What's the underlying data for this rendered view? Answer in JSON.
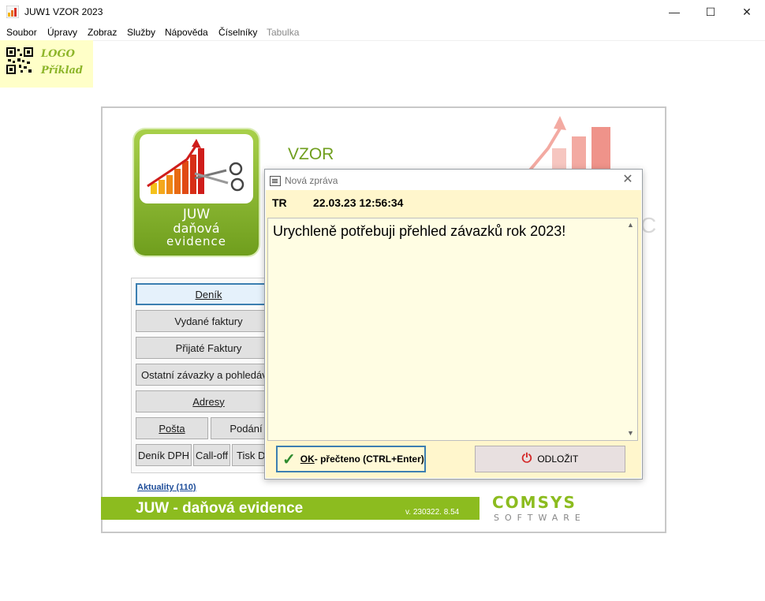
{
  "window": {
    "title": "JUW1 VZOR 2023",
    "minimize_glyph": "—",
    "maximize_glyph": "☐",
    "close_glyph": "✕"
  },
  "menu": [
    "Soubor",
    "Úpravy",
    "Zobraz",
    "Služby",
    "Nápověda",
    "Číselníky",
    "Tabulka"
  ],
  "logo": {
    "line1": "LOGO",
    "line2": "Příklad",
    "icon": "qr-code-icon"
  },
  "app_logo": {
    "line1": "JUW",
    "line2": "daňová",
    "line3": "evidence"
  },
  "company": "VZOR",
  "buttons": {
    "denik": "Deník",
    "vydane": "Vydané faktury",
    "prijate": "Přijaté Faktury",
    "ostatni": "Ostatní závazky a pohledávky",
    "adresy": "Adresy",
    "posta": "Pošta",
    "podani": "Podání",
    "denik_dph": "Deník DPH",
    "calloff": "Call-off",
    "tisk": "Tisk D"
  },
  "aktuality": "Aktuality (110)",
  "footer": {
    "title": "JUW - daňová evidence",
    "version": "v. 230322. 8.54"
  },
  "brand": {
    "line1": "COMSYS",
    "line2": "SOFTWARE"
  },
  "dialog": {
    "title": "Nová zpráva",
    "close_glyph": "✕",
    "sender": "TR",
    "timestamp": "22.03.23 12:56:34",
    "message": "Urychleně potřebuji přehled závazků rok 2023!",
    "ok_mnemonic": "OK",
    "ok_rest": " - přečteno (CTRL+Enter)",
    "later_label": "ODLOŽIT"
  },
  "colors": {
    "accent": "#8cbc1f",
    "dialog_bg": "#fff6cc",
    "focus": "#3c7fb1"
  }
}
